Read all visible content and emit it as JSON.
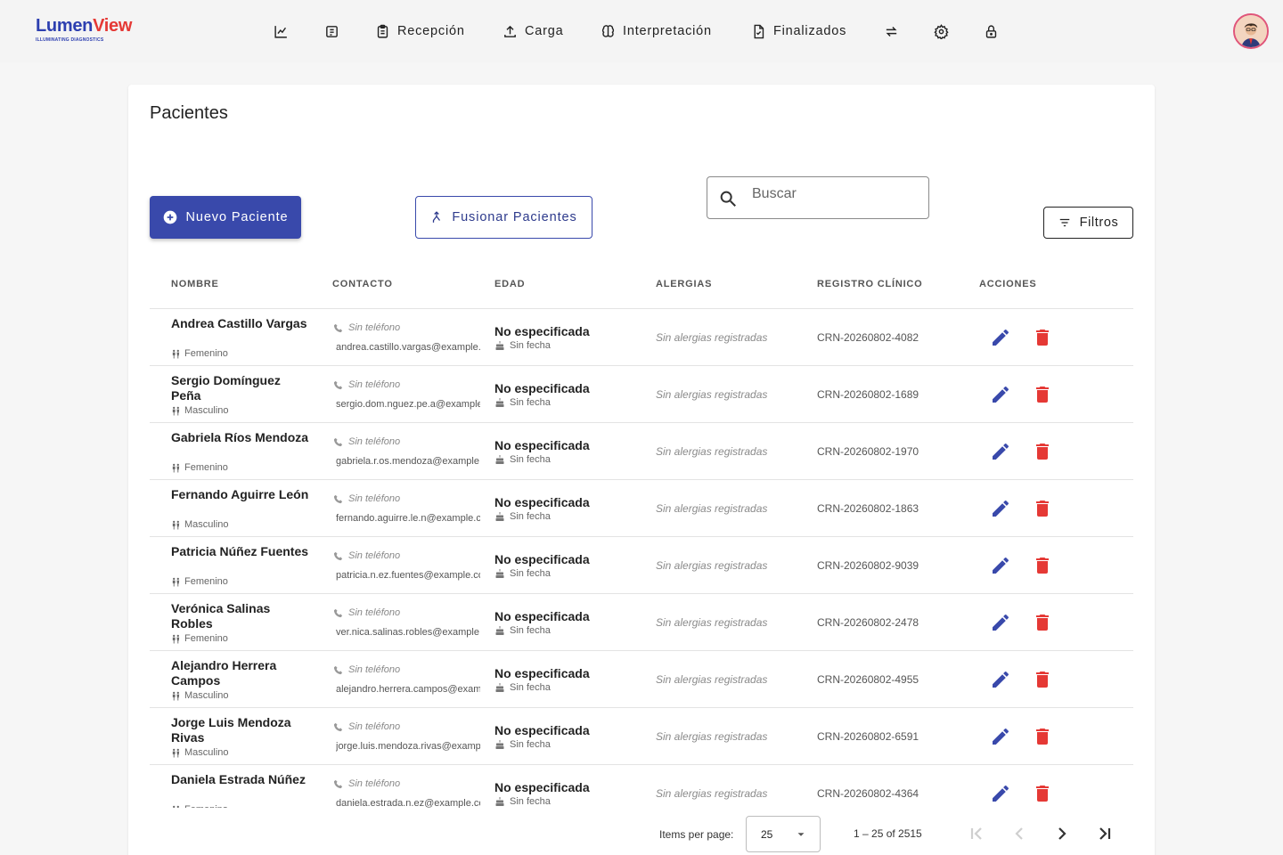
{
  "app": {
    "logo_part1": "Lumen",
    "logo_part2": "View",
    "logo_tagline": "ILLUMINATING DIAGNOSTICS"
  },
  "nav": {
    "items": [
      {
        "icon": "chart-icon",
        "label": ""
      },
      {
        "icon": "tag-icon",
        "label": ""
      },
      {
        "icon": "clipboard-icon",
        "label": "Recepción"
      },
      {
        "icon": "upload-icon",
        "label": "Carga"
      },
      {
        "icon": "brain-icon",
        "label": "Interpretación"
      },
      {
        "icon": "document-check-icon",
        "label": "Finalizados"
      },
      {
        "icon": "swap-icon",
        "label": ""
      },
      {
        "icon": "gear-icon",
        "label": ""
      },
      {
        "icon": "lock-icon",
        "label": ""
      }
    ]
  },
  "page": {
    "title": "Pacientes",
    "new_button": "Nuevo Paciente",
    "merge_button": "Fusionar Pacientes",
    "search_placeholder": "Buscar",
    "filter_button": "Filtros"
  },
  "table": {
    "headers": {
      "name": "NOMBRE",
      "contact": "CONTACTO",
      "age": "EDAD",
      "allergies": "ALERGIAS",
      "record": "REGISTRO CLÍNICO",
      "actions": "ACCIONES"
    },
    "rows": [
      {
        "name": "Andrea Castillo Vargas",
        "sex": "Femenino",
        "phone": "Sin teléfono",
        "email": "andrea.castillo.vargas@example.com",
        "age": "No especificada",
        "dob": "Sin fecha",
        "allergies": "Sin alergias registradas",
        "record": "CRN-20260802-4082"
      },
      {
        "name": "Sergio Domínguez Peña",
        "sex": "Masculino",
        "phone": "Sin teléfono",
        "email": "sergio.dom.nguez.pe.a@example.com",
        "age": "No especificada",
        "dob": "Sin fecha",
        "allergies": "Sin alergias registradas",
        "record": "CRN-20260802-1689"
      },
      {
        "name": "Gabriela Ríos Mendoza",
        "sex": "Femenino",
        "phone": "Sin teléfono",
        "email": "gabriela.r.os.mendoza@example.com",
        "age": "No especificada",
        "dob": "Sin fecha",
        "allergies": "Sin alergias registradas",
        "record": "CRN-20260802-1970"
      },
      {
        "name": "Fernando Aguirre León",
        "sex": "Masculino",
        "phone": "Sin teléfono",
        "email": "fernando.aguirre.le.n@example.com",
        "age": "No especificada",
        "dob": "Sin fecha",
        "allergies": "Sin alergias registradas",
        "record": "CRN-20260802-1863"
      },
      {
        "name": "Patricia Núñez Fuentes",
        "sex": "Femenino",
        "phone": "Sin teléfono",
        "email": "patricia.n.ez.fuentes@example.com",
        "age": "No especificada",
        "dob": "Sin fecha",
        "allergies": "Sin alergias registradas",
        "record": "CRN-20260802-9039"
      },
      {
        "name": "Verónica Salinas Robles",
        "sex": "Femenino",
        "phone": "Sin teléfono",
        "email": "ver.nica.salinas.robles@example.com",
        "age": "No especificada",
        "dob": "Sin fecha",
        "allergies": "Sin alergias registradas",
        "record": "CRN-20260802-2478"
      },
      {
        "name": "Alejandro Herrera Campos",
        "sex": "Masculino",
        "phone": "Sin teléfono",
        "email": "alejandro.herrera.campos@example.com",
        "age": "No especificada",
        "dob": "Sin fecha",
        "allergies": "Sin alergias registradas",
        "record": "CRN-20260802-4955"
      },
      {
        "name": "Jorge Luis Mendoza Rivas",
        "sex": "Masculino",
        "phone": "Sin teléfono",
        "email": "jorge.luis.mendoza.rivas@example.com",
        "age": "No especificada",
        "dob": "Sin fecha",
        "allergies": "Sin alergias registradas",
        "record": "CRN-20260802-6591"
      },
      {
        "name": "Daniela Estrada Núñez",
        "sex": "Femenino",
        "phone": "Sin teléfono",
        "email": "daniela.estrada.n.ez@example.com",
        "age": "No especificada",
        "dob": "Sin fecha",
        "allergies": "Sin alergias registradas",
        "record": "CRN-20260802-4364"
      }
    ]
  },
  "paginator": {
    "items_label": "Items per page:",
    "page_size": "25",
    "range": "1 – 25 of 2515"
  },
  "colors": {
    "primary": "#3949ab",
    "danger": "#e53935",
    "logo_blue": "#2d3fb0",
    "logo_red": "#e53935"
  }
}
